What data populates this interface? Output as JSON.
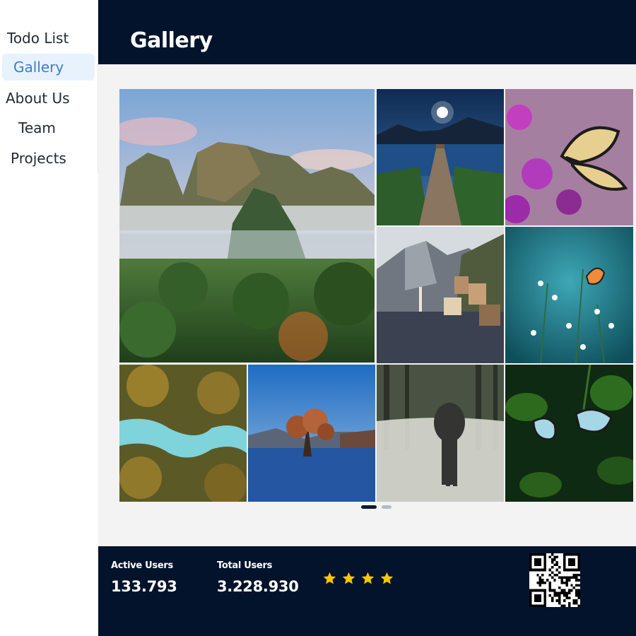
{
  "sidebar": {
    "items": [
      {
        "label": "Todo List"
      },
      {
        "label": "Gallery"
      },
      {
        "label": "About Us"
      },
      {
        "label": "Team"
      },
      {
        "label": "Projects"
      }
    ],
    "active": "Gallery"
  },
  "header": {
    "title": "Gallery"
  },
  "gallery": {
    "images": [
      {
        "subject": "misty tropical mountains with palm trees"
      },
      {
        "subject": "wooden pier on lake at night with moon"
      },
      {
        "subject": "swallowtail butterfly on purple flowers"
      },
      {
        "subject": "alpine lakeside village under mountains"
      },
      {
        "subject": "orange butterfly on daisies, teal background"
      },
      {
        "subject": "aerial river through autumn forest"
      },
      {
        "subject": "lone tree standing in lake"
      },
      {
        "subject": "elephant walking on misty forest road"
      },
      {
        "subject": "two blue butterflies on green leaves"
      }
    ],
    "pagination": {
      "pages": 2,
      "current": 1
    }
  },
  "footer": {
    "active_users_label": "Active Users",
    "active_users_value": "133.793",
    "total_users_label": "Total Users",
    "total_users_value": "3.228.930",
    "rating_stars": 4,
    "star_color": "#f5c800",
    "qr_icon": "qr-code-icon"
  },
  "colors": {
    "navy": "#03132c",
    "active_nav_bg": "#e8f2fd",
    "active_nav_text": "#3d7dc8",
    "content_bg": "#f3f3f3"
  }
}
